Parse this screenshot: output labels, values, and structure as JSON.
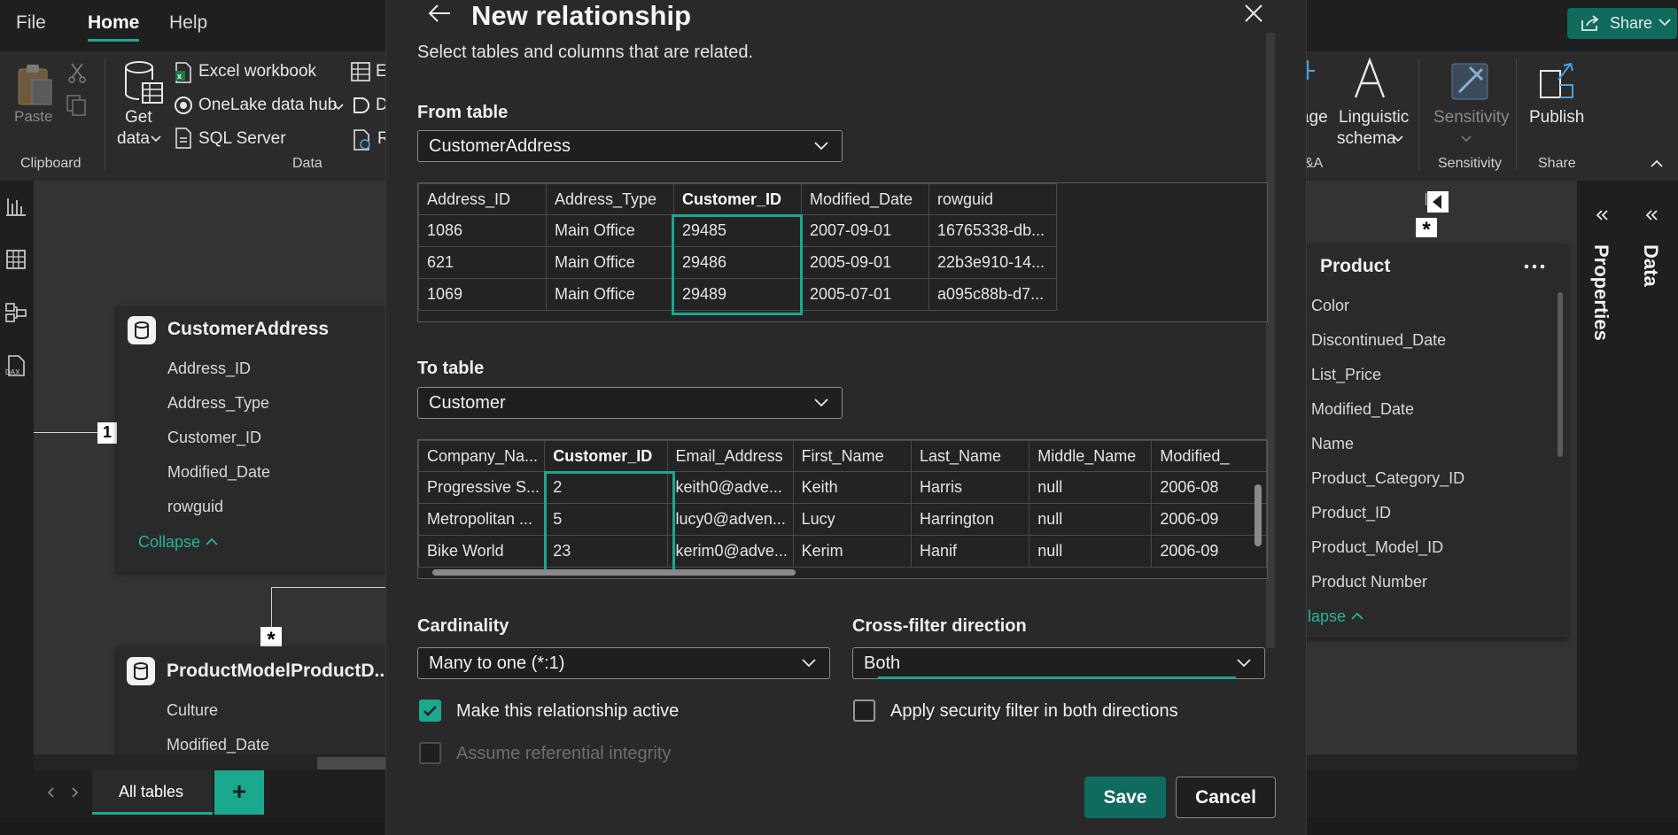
{
  "menu": {
    "file": "File",
    "home": "Home",
    "help": "Help",
    "share": "Share"
  },
  "ribbon": {
    "paste": "Paste",
    "clipboard_group": "Clipboard",
    "get_data_line1": "Get",
    "get_data_line2": "data",
    "excel": "Excel workbook",
    "onelake": "OneLake data hub",
    "sql": "SQL Server",
    "data_group": "Data",
    "partial_e": "E",
    "partial_d": "D",
    "partial_r": "R",
    "partial_age": "age",
    "linguistic_line1": "Linguistic",
    "linguistic_line2": "schema",
    "qa_group": "&A",
    "sensitivity": "Sensitivity",
    "sensitivity_group": "Sensitivity",
    "publish": "Publish",
    "share_group": "Share"
  },
  "canvas": {
    "customer_address": {
      "title": "CustomerAddress",
      "fields": [
        "Address_ID",
        "Address_Type",
        "Customer_ID",
        "Modified_Date",
        "rowguid"
      ],
      "collapse": "Collapse"
    },
    "product_model": {
      "title": "ProductModelProductD...",
      "fields": [
        "Culture",
        "Modified_Date"
      ]
    },
    "product": {
      "title": "Product",
      "fields": [
        "Color",
        "Discontinued_Date",
        "List_Price",
        "Modified_Date",
        "Name",
        "Product_Category_ID",
        "Product_ID",
        "Product_Model_ID",
        "Product Number"
      ],
      "collapse": "ollapse"
    },
    "badge_one": "1",
    "badge_many": "*"
  },
  "panes": {
    "properties": "Properties",
    "data": "Data"
  },
  "tabs": {
    "all_tables": "All tables",
    "add": "+"
  },
  "dialog": {
    "title": "New relationship",
    "subtitle": "Select tables and columns that are related.",
    "from_label": "From table",
    "from_value": "CustomerAddress",
    "from_grid": {
      "columns": [
        "Address_ID",
        "Address_Type",
        "Customer_ID",
        "Modified_Date",
        "rowguid"
      ],
      "selected_column": "Customer_ID",
      "rows": [
        [
          "1086",
          "Main Office",
          "29485",
          "2007-09-01",
          "16765338-db..."
        ],
        [
          "621",
          "Main Office",
          "29486",
          "2005-09-01",
          "22b3e910-14..."
        ],
        [
          "1069",
          "Main Office",
          "29489",
          "2005-07-01",
          "a095c88b-d7..."
        ]
      ]
    },
    "to_label": "To table",
    "to_value": "Customer",
    "to_grid": {
      "columns": [
        "Company_Na...",
        "Customer_ID",
        "Email_Address",
        "First_Name",
        "Last_Name",
        "Middle_Name",
        "Modified_"
      ],
      "selected_column": "Customer_ID",
      "rows": [
        [
          "Progressive S...",
          "2",
          "keith0@adve...",
          "Keith",
          "Harris",
          "null",
          "2006-08"
        ],
        [
          "Metropolitan ...",
          "5",
          "lucy0@adven...",
          "Lucy",
          "Harrington",
          "null",
          "2006-09"
        ],
        [
          "Bike World",
          "23",
          "kerim0@adve...",
          "Kerim",
          "Hanif",
          "null",
          "2006-09"
        ]
      ]
    },
    "cardinality_label": "Cardinality",
    "cardinality_value": "Many to one (*:1)",
    "crossfilter_label": "Cross-filter direction",
    "crossfilter_value": "Both",
    "active_label": "Make this relationship active",
    "active_checked": true,
    "security_label": "Apply security filter in both directions",
    "security_checked": false,
    "integrity_label": "Assume referential integrity",
    "integrity_enabled": false,
    "save": "Save",
    "cancel": "Cancel"
  },
  "colors": {
    "accent": "#1aa88f",
    "primary_button": "#0e6b5d",
    "dialog_bg": "#292929"
  }
}
